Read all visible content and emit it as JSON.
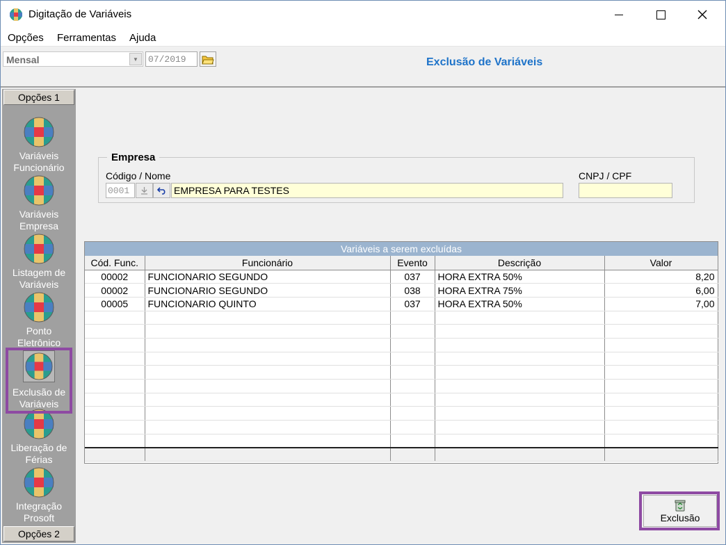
{
  "window": {
    "title": "Digitação de Variáveis"
  },
  "menu": [
    {
      "label": "Opções"
    },
    {
      "label": "Ferramentas"
    },
    {
      "label": "Ajuda"
    }
  ],
  "toolbar": {
    "period": "Mensal",
    "date": "07/2019"
  },
  "page": {
    "title": "Exclusão de Variáveis"
  },
  "sidebar": {
    "header_top": "Opções 1",
    "header_bottom": "Opções 2",
    "items": [
      {
        "label": "Variáveis Funcionário"
      },
      {
        "label": "Variáveis Empresa"
      },
      {
        "label": "Listagem de Variáveis"
      },
      {
        "label": "Ponto Eletrônico"
      },
      {
        "label": "Exclusão de Variáveis"
      },
      {
        "label": "Liberação de Férias"
      },
      {
        "label": "Integração Prosoft"
      }
    ]
  },
  "empresa": {
    "group_title": "Empresa",
    "code_label": "Código / Nome",
    "code": "0001",
    "name": "EMPRESA PARA TESTES",
    "cnpj_label": "CNPJ / CPF",
    "cnpj": ""
  },
  "grid": {
    "caption": "Variáveis a serem excluídas",
    "columns": [
      "Cód. Func.",
      "Funcionário",
      "Evento",
      "Descrição",
      "Valor"
    ],
    "rows": [
      [
        "00002",
        "FUNCIONARIO SEGUNDO",
        "037",
        "HORA EXTRA 50%",
        "8,20"
      ],
      [
        "00002",
        "FUNCIONARIO SEGUNDO",
        "038",
        "HORA EXTRA 75%",
        "6,00"
      ],
      [
        "00005",
        "FUNCIONARIO QUINTO",
        "037",
        "HORA EXTRA 50%",
        "7,00"
      ]
    ]
  },
  "actions": {
    "exclusao_label": "Exclusão"
  },
  "colors": {
    "accent": "#1e73c9",
    "highlight": "#8e4aa3",
    "caption": "#9bb4cf",
    "input_yellow": "#ffffd8"
  }
}
